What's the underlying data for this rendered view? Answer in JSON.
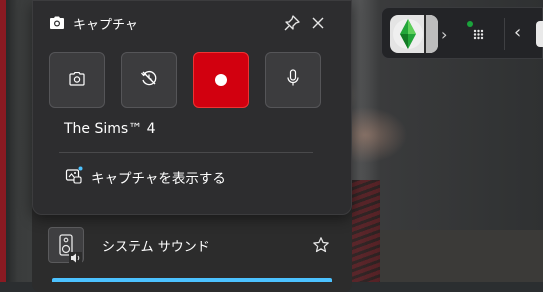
{
  "capture": {
    "title": "キャプチャ",
    "title_icon": "camera-icon",
    "pin_icon": "pin-icon",
    "close_icon": "close-icon",
    "buttons": [
      {
        "name": "screenshot",
        "icon": "camera-icon"
      },
      {
        "name": "record-last",
        "icon": "history-icon"
      },
      {
        "name": "start-recording",
        "icon": "record-dot",
        "active_color": "#d2000f"
      },
      {
        "name": "microphone",
        "icon": "microphone-icon"
      }
    ],
    "game_name": "The Sims™ 4",
    "show_captures_label": "キャプチャを表示する"
  },
  "audio": {
    "label": "システム サウンド",
    "icon": "speaker-icon",
    "favorite_icon": "star-icon"
  },
  "gamebar": {
    "app_icon": "sims-plumbob-icon",
    "expand_icon": "chevron-right-icon",
    "widgets_icon": "widget-menu-icon",
    "collapse_icon": "chevron-left-icon"
  },
  "colors": {
    "accent_blue": "#4cc2ff",
    "record_red": "#d2000f",
    "status_green": "#1aa33b"
  }
}
